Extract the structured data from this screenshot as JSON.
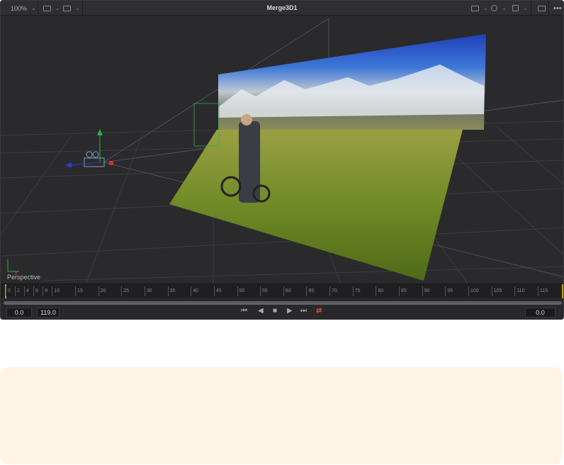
{
  "toolbar": {
    "zoom": "100%",
    "title": "Merge3D1"
  },
  "viewport": {
    "label": "Perspective",
    "axis_x": "X",
    "axis_y": "Y"
  },
  "timeline": {
    "ticks": [
      "0",
      "2",
      "4",
      "6",
      "8",
      "10",
      "15",
      "20",
      "25",
      "30",
      "35",
      "40",
      "45",
      "50",
      "55",
      "60",
      "65",
      "70",
      "75",
      "80",
      "85",
      "90",
      "95",
      "100",
      "105",
      "110",
      "115"
    ],
    "start": "0.0",
    "end": "119.0",
    "current": "0.0",
    "playhead": 0,
    "range_end": 119
  },
  "transport": {
    "first": "⏮",
    "prev": "◀",
    "stop": "■",
    "play": "▶",
    "last": "⏭",
    "loop": "⇄"
  },
  "colors": {
    "loop_active": "#e0472f",
    "playhead": "#c8a020",
    "note_bg": "#fff4e6"
  }
}
